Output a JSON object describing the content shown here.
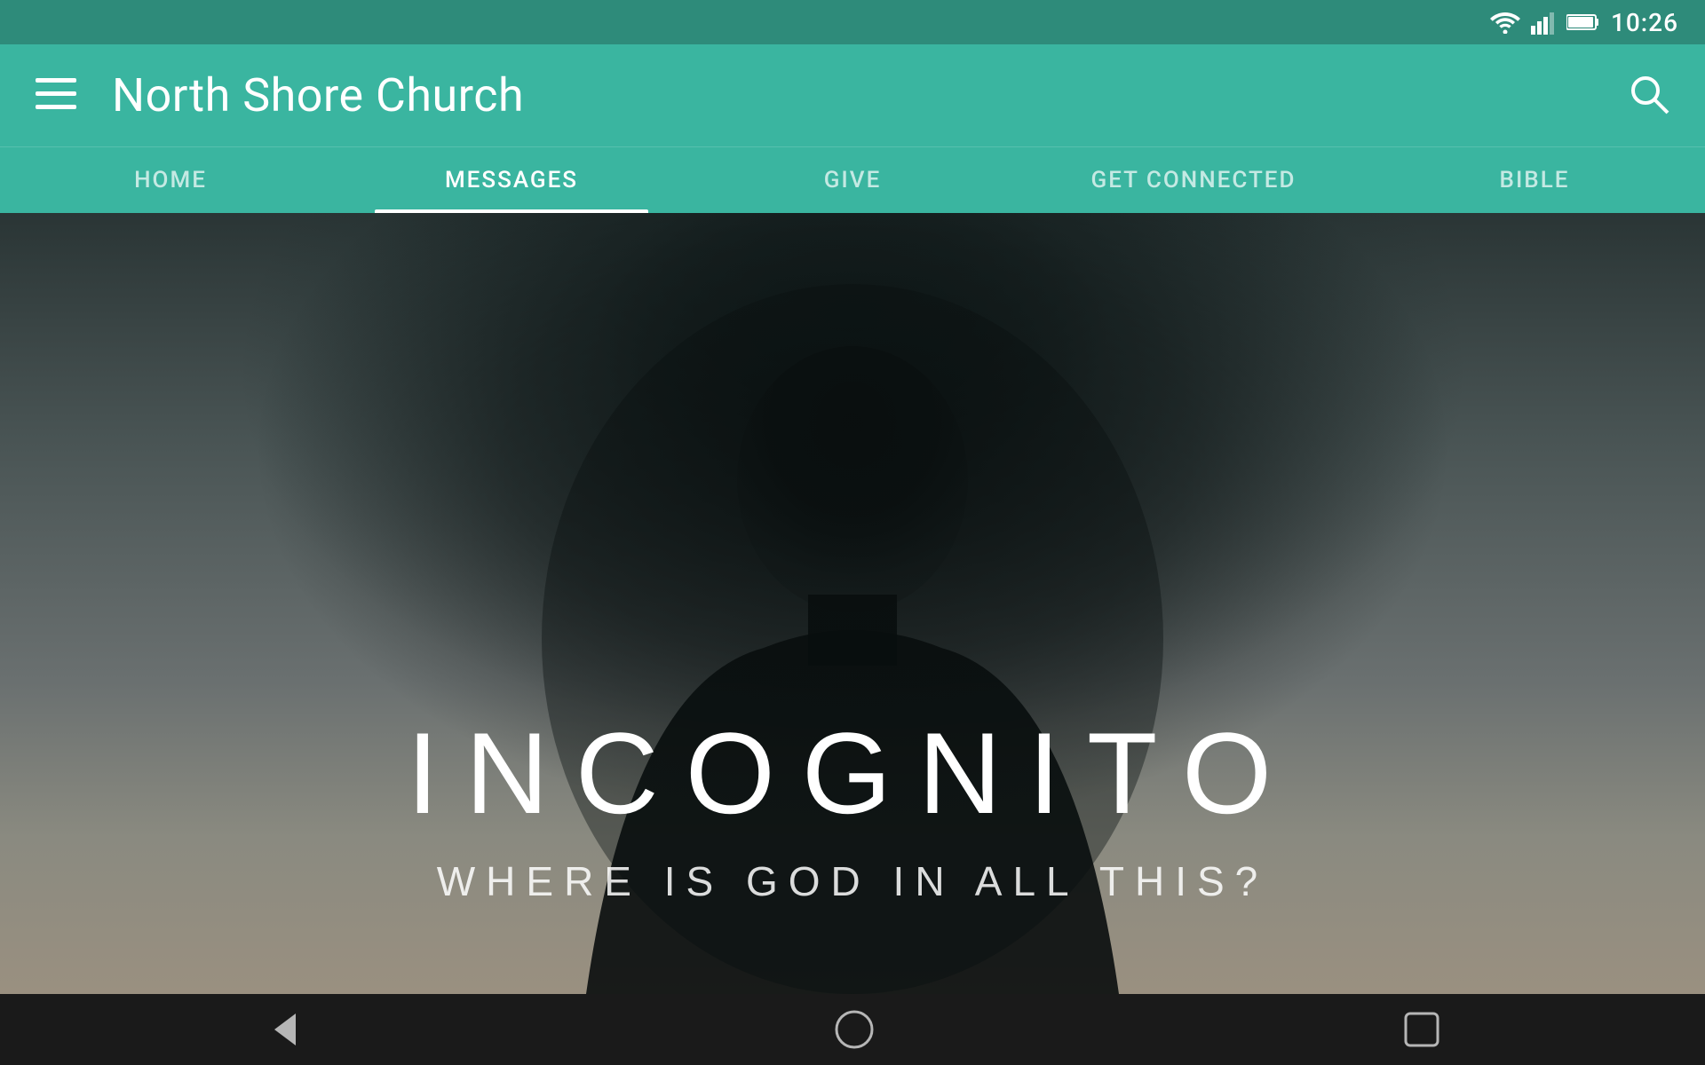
{
  "statusBar": {
    "time": "10:26"
  },
  "appBar": {
    "title": "North Shore Church",
    "menuLabel": "menu",
    "searchLabel": "search"
  },
  "navTabs": [
    {
      "id": "home",
      "label": "HOME",
      "active": false
    },
    {
      "id": "messages",
      "label": "MESSAGES",
      "active": true
    },
    {
      "id": "give",
      "label": "GIVE",
      "active": false
    },
    {
      "id": "get-connected",
      "label": "GET CONNECTED",
      "active": false
    },
    {
      "id": "bible",
      "label": "BIBLE",
      "active": false
    }
  ],
  "hero": {
    "title": "INCOGNITO",
    "subtitle": "WHERE IS GOD IN ALL THIS?"
  },
  "bottomNav": {
    "back": "back",
    "home": "home",
    "recent": "recent"
  }
}
